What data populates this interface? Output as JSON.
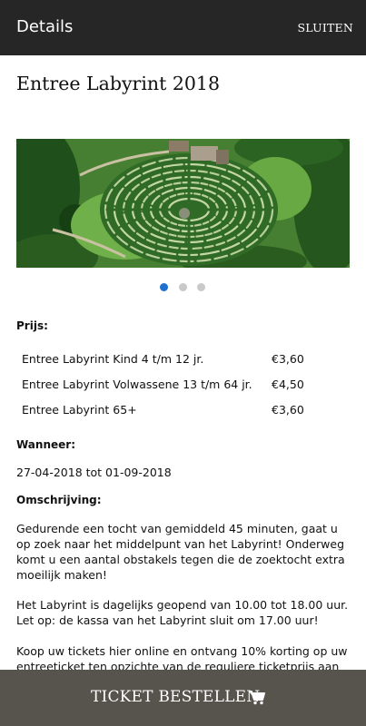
{
  "appbar": {
    "title": "Details",
    "close_label": "SLUITEN"
  },
  "page": {
    "title": "Entree Labyrint 2018"
  },
  "gallery": {
    "image": "maze-aerial-photo",
    "slides": 3,
    "active_slide": 1
  },
  "prijs": {
    "label": "Prijs:",
    "rows": [
      {
        "name": "Entree Labyrint Kind 4 t/m 12 jr.",
        "price": "€3,60"
      },
      {
        "name": "Entree Labyrint Volwassene 13 t/m 64 jr.",
        "price": "€4,50"
      },
      {
        "name": "Entree Labyrint 65+",
        "price": "€3,60"
      }
    ]
  },
  "wanneer": {
    "label": "Wanneer:",
    "value": "27-04-2018 tot 01-09-2018"
  },
  "omschrijving": {
    "label": "Omschrijving:",
    "para1": "Gedurende een tocht van gemiddeld 45 minuten, gaat u op zoek naar het middelpunt van het Labyrint! Onderweg komt u een aantal obstakels tegen die de zoektocht extra moeilijk maken!",
    "para2_line1": "Het Labyrint is dagelijks geopend van 10.00 tot 18.00 uur.",
    "para2_line2": "Let op: de kassa van het Labyrint sluit om 17.00 uur!",
    "para3": "Koop uw tickets hier online en ontvang 10% korting op uw entreeticket ten opzichte van de reguliere ticketprijs aan de kassa."
  },
  "bottom": {
    "order_label": "TICKET BESTELLEN",
    "icon": "shopping-cart-icon"
  },
  "colors": {
    "appbar": "#262626",
    "bottom_bar": "#57534d",
    "active_dot": "#1f6fd1"
  }
}
